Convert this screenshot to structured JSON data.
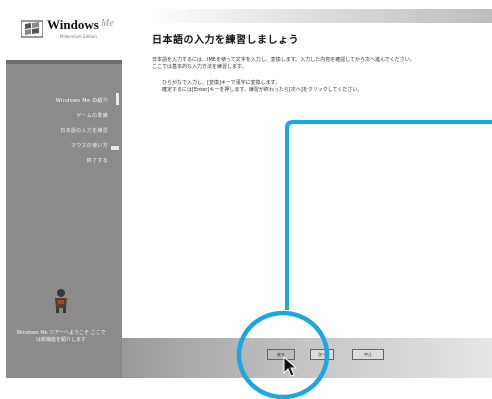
{
  "app": {
    "logo_text": "Windows",
    "logo_sup": "Me",
    "logo_sub": "Millennium Edition"
  },
  "sidebar": {
    "items": [
      {
        "label": "Windows Me の紹介",
        "current": true
      },
      {
        "label": "ゲームの準備"
      },
      {
        "label": "日本語の入力を練習"
      },
      {
        "label": "マウスの使い方"
      },
      {
        "label": "終了する"
      }
    ],
    "note": "Windows Me ツアーへようこそ ここでは新機能を紹介します"
  },
  "main": {
    "title": "日本語の入力を練習しましょう",
    "paragraph1": [
      "日本語を入力するには、IMEを使って文字を入力し、変換します。入力した内容を確認してから次へ進んでください。",
      "ここでは基本的な入力方法を練習します。"
    ],
    "paragraph2": [
      "ひらがなで入力し、[変換]キーで漢字に変換します。",
      "確定するには[Enter]キーを押します。練習が終わったら[次へ]をクリックしてください。"
    ]
  },
  "buttons": {
    "back": "戻る",
    "next": "次へ",
    "cancel": "中止"
  },
  "colors": {
    "sidebar": "#8b8b8b",
    "callout": "#1aa7e3"
  },
  "icons": {
    "logo": "windows-flag-icon",
    "mascot": "mascot-icon",
    "cursor": "mouse-pointer-icon"
  }
}
